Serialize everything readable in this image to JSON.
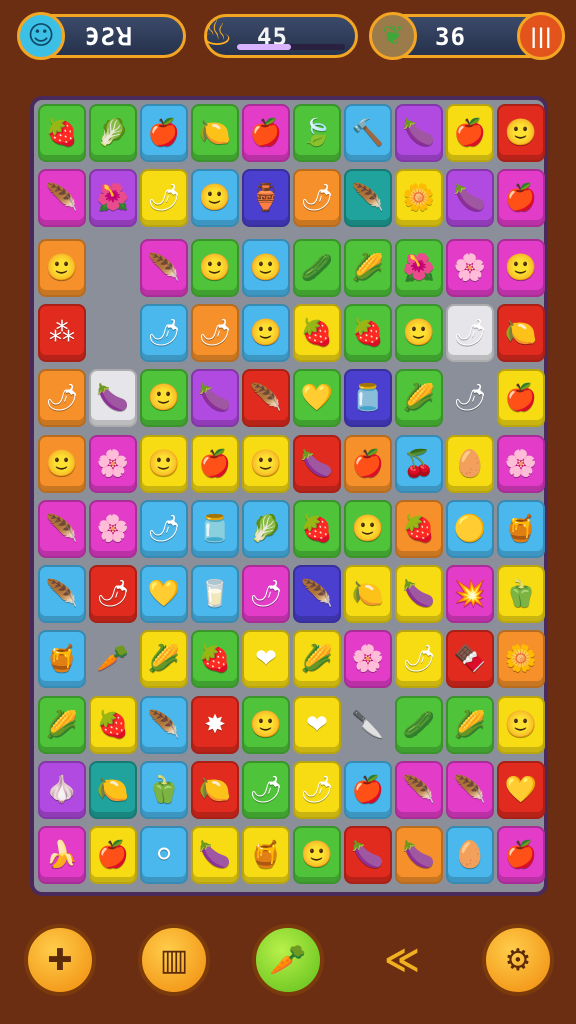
{
  "hud": {
    "score_value": "ЭƧꓤ",
    "moves_value": "45",
    "moves_progress": 0.5,
    "coins_value": "36",
    "left_badge_icon": "smiley-icon",
    "mid_badge_icon": "fire-icon",
    "right_badge_icon": "leaf-icon",
    "pause_icon": "pause-icon"
  },
  "colors": {
    "G": "#4fc43a",
    "R": "#e02b1e",
    "Y": "#f7dc14",
    "P": "#b04ae0",
    "M": "#e23cc9",
    "B": "#4ab8ec",
    "O": "#f5902a",
    "D": "#4b3fd0",
    "T": "#1fa39c",
    "W": "#e6e6ea",
    "E": "#8a8f99"
  },
  "board": {
    "rows": [
      [
        [
          "G",
          "🍓"
        ],
        [
          "G",
          "🥬"
        ],
        [
          "B",
          "🍎"
        ],
        [
          "G",
          "🍋"
        ],
        [
          "M",
          "🍎"
        ],
        [
          "G",
          "🍃"
        ],
        [
          "B",
          "🔨"
        ],
        [
          "P",
          "🍆"
        ],
        [
          "Y",
          "🍎"
        ],
        [
          "R",
          "🙂"
        ]
      ],
      [
        [
          "M",
          "🪶"
        ],
        [
          "P",
          "🌺"
        ],
        [
          "Y",
          "🌶"
        ],
        [
          "B",
          "🙂"
        ],
        [
          "D",
          "🏺"
        ],
        [
          "O",
          "🌶"
        ],
        [
          "T",
          "🪶"
        ],
        [
          "Y",
          "🌼"
        ],
        [
          "P",
          "🍆"
        ],
        [
          "M",
          "🍎"
        ]
      ],
      [
        [
          "O",
          "🙂"
        ],
        [
          "E",
          ""
        ],
        [
          "M",
          "🪶"
        ],
        [
          "G",
          "🙂"
        ],
        [
          "B",
          "🙂"
        ],
        [
          "G",
          "🥒"
        ],
        [
          "G",
          "🌽"
        ],
        [
          "G",
          "🌺"
        ],
        [
          "M",
          "🌸"
        ],
        [
          "M",
          "🙂"
        ]
      ],
      [
        [
          "R",
          "⁂"
        ],
        [
          "E",
          ""
        ],
        [
          "B",
          "🌶"
        ],
        [
          "O",
          "🌶"
        ],
        [
          "B",
          "🙂"
        ],
        [
          "Y",
          "🍓"
        ],
        [
          "G",
          "🍓"
        ],
        [
          "G",
          "🙂"
        ],
        [
          "W",
          "🌶"
        ],
        [
          "R",
          "🍋"
        ]
      ],
      [
        [
          "O",
          "🌶"
        ],
        [
          "W",
          "🍆"
        ],
        [
          "G",
          "🙂"
        ],
        [
          "P",
          "🍆"
        ],
        [
          "R",
          "🪶"
        ],
        [
          "G",
          "💛"
        ],
        [
          "D",
          "🫙"
        ],
        [
          "G",
          "🌽"
        ],
        [
          "E",
          "🌶"
        ],
        [
          "Y",
          "🍎"
        ]
      ],
      [
        [
          "O",
          "🙂"
        ],
        [
          "M",
          "🌸"
        ],
        [
          "Y",
          "🙂"
        ],
        [
          "Y",
          "🍎"
        ],
        [
          "Y",
          "🙂"
        ],
        [
          "R",
          "🍆"
        ],
        [
          "O",
          "🍎"
        ],
        [
          "B",
          "🍒"
        ],
        [
          "Y",
          "🥚"
        ],
        [
          "M",
          "🌸"
        ]
      ],
      [
        [
          "M",
          "🪶"
        ],
        [
          "M",
          "🌸"
        ],
        [
          "B",
          "🌶"
        ],
        [
          "B",
          "🫙"
        ],
        [
          "B",
          "🥬"
        ],
        [
          "G",
          "🍓"
        ],
        [
          "G",
          "🙂"
        ],
        [
          "O",
          "🍓"
        ],
        [
          "B",
          "🟡"
        ],
        [
          "B",
          "🍯"
        ]
      ],
      [
        [
          "B",
          "🪶"
        ],
        [
          "R",
          "🌶"
        ],
        [
          "B",
          "💛"
        ],
        [
          "B",
          "🥛"
        ],
        [
          "M",
          "🌶"
        ],
        [
          "D",
          "🪶"
        ],
        [
          "Y",
          "🍋"
        ],
        [
          "Y",
          "🍆"
        ],
        [
          "M",
          "💥"
        ],
        [
          "Y",
          "🫑"
        ]
      ],
      [
        [
          "B",
          "🍯"
        ],
        [
          "E",
          "🥕"
        ],
        [
          "Y",
          "🌽"
        ],
        [
          "G",
          "🍓"
        ],
        [
          "Y",
          "❤"
        ],
        [
          "Y",
          "🌽"
        ],
        [
          "M",
          "🌸"
        ],
        [
          "Y",
          "🌶"
        ],
        [
          "R",
          "🍫"
        ],
        [
          "O",
          "🌼"
        ]
      ],
      [
        [
          "G",
          "🌽"
        ],
        [
          "Y",
          "🍓"
        ],
        [
          "B",
          "🪶"
        ],
        [
          "R",
          "✸"
        ],
        [
          "G",
          "🙂"
        ],
        [
          "Y",
          "❤"
        ],
        [
          "E",
          "🔪"
        ],
        [
          "G",
          "🥒"
        ],
        [
          "G",
          "🌽"
        ],
        [
          "Y",
          "🙂"
        ]
      ],
      [
        [
          "P",
          "🧄"
        ],
        [
          "T",
          "🍋"
        ],
        [
          "B",
          "🫑"
        ],
        [
          "R",
          "🍋"
        ],
        [
          "G",
          "🌶"
        ],
        [
          "Y",
          "🌶"
        ],
        [
          "B",
          "🍎"
        ],
        [
          "M",
          "🪶"
        ],
        [
          "M",
          "🪶"
        ],
        [
          "R",
          "💛"
        ]
      ],
      [
        [
          "M",
          "🍌"
        ],
        [
          "Y",
          "🍎"
        ],
        [
          "B",
          "⚪"
        ],
        [
          "Y",
          "🍆"
        ],
        [
          "Y",
          "🍯"
        ],
        [
          "G",
          "🙂"
        ],
        [
          "R",
          "🍆"
        ],
        [
          "O",
          "🍆"
        ],
        [
          "B",
          "🥚"
        ],
        [
          "M",
          "🍎"
        ]
      ]
    ]
  },
  "bottom": {
    "buttons": [
      {
        "name": "puzzle-button",
        "icon": "puzzle-icon",
        "glyph": "✚"
      },
      {
        "name": "menu-button",
        "icon": "shop-icon",
        "glyph": "▥"
      },
      {
        "name": "hint-button",
        "icon": "carrot-icon",
        "glyph": "🥕"
      },
      {
        "name": "undo-button",
        "icon": "back-arrow-icon",
        "glyph": "≪"
      },
      {
        "name": "settings-button",
        "icon": "gear-icon",
        "glyph": "⚙"
      }
    ]
  }
}
